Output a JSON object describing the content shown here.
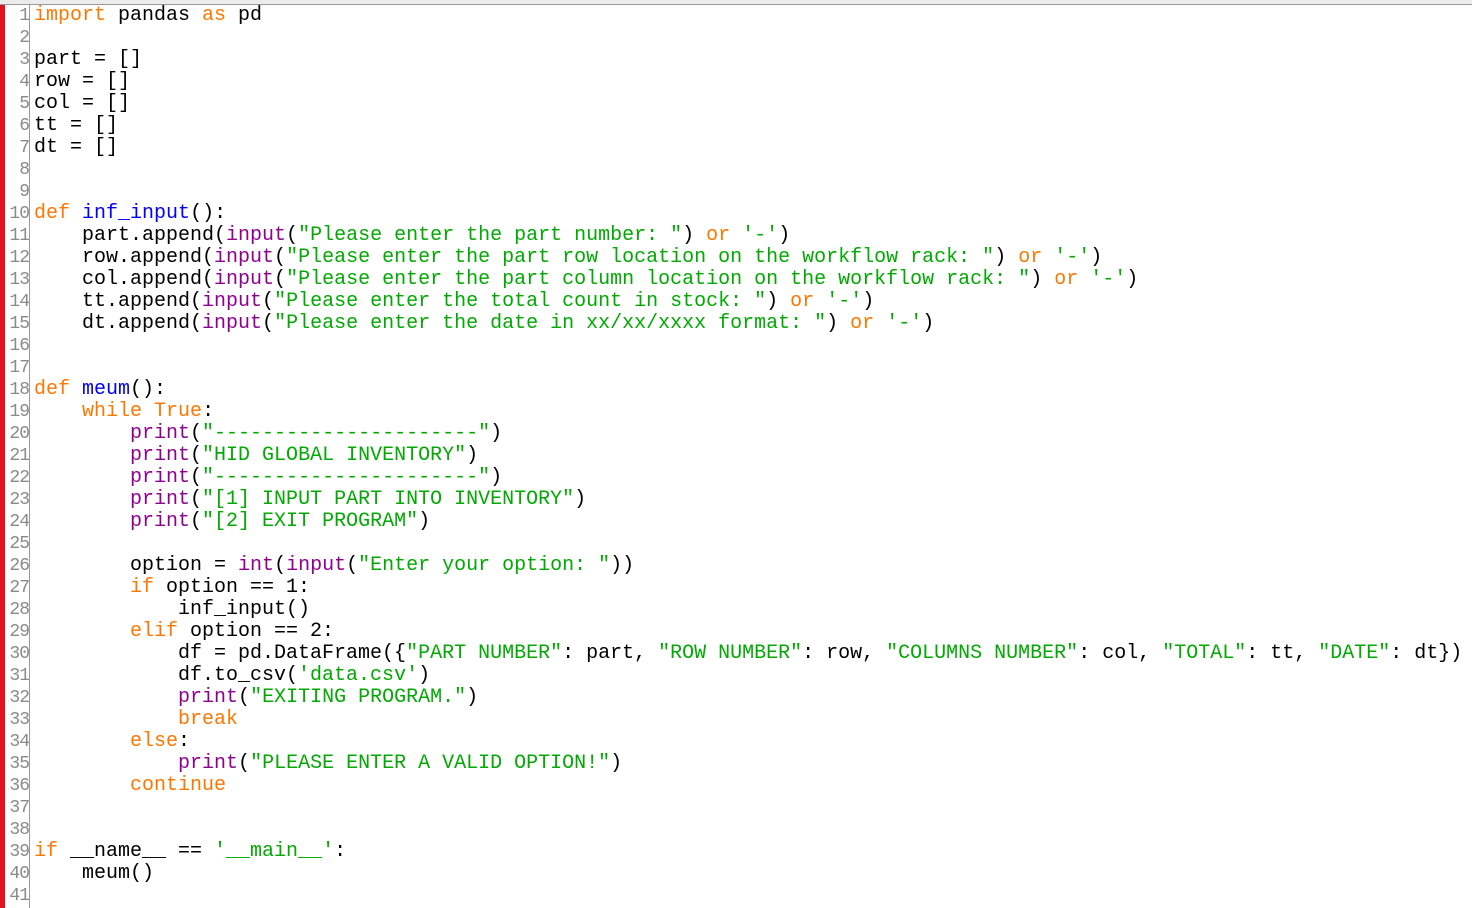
{
  "editor": {
    "colors": {
      "keyword": "#ff7700",
      "function_def": "#0000ff",
      "builtin": "#900090",
      "string": "#00aa00",
      "plain": "#000000",
      "line_number": "#8a8a8a",
      "margin_marker": "#e0141e"
    },
    "lines": [
      {
        "n": "1",
        "tokens": [
          {
            "t": "kw",
            "v": "import"
          },
          {
            "t": "pl",
            "v": " pandas "
          },
          {
            "t": "kw",
            "v": "as"
          },
          {
            "t": "pl",
            "v": " pd"
          }
        ]
      },
      {
        "n": "2",
        "tokens": []
      },
      {
        "n": "3",
        "tokens": [
          {
            "t": "pl",
            "v": "part = []"
          }
        ]
      },
      {
        "n": "4",
        "tokens": [
          {
            "t": "pl",
            "v": "row = []"
          }
        ]
      },
      {
        "n": "5",
        "tokens": [
          {
            "t": "pl",
            "v": "col = []"
          }
        ]
      },
      {
        "n": "6",
        "tokens": [
          {
            "t": "pl",
            "v": "tt = []"
          }
        ]
      },
      {
        "n": "7",
        "tokens": [
          {
            "t": "pl",
            "v": "dt = []"
          }
        ]
      },
      {
        "n": "8",
        "tokens": []
      },
      {
        "n": "9",
        "tokens": []
      },
      {
        "n": "10",
        "tokens": [
          {
            "t": "kw",
            "v": "def"
          },
          {
            "t": "pl",
            "v": " "
          },
          {
            "t": "fn",
            "v": "inf_input"
          },
          {
            "t": "pl",
            "v": "():"
          }
        ]
      },
      {
        "n": "11",
        "tokens": [
          {
            "t": "pl",
            "v": "    part.append("
          },
          {
            "t": "bi",
            "v": "input"
          },
          {
            "t": "pl",
            "v": "("
          },
          {
            "t": "str",
            "v": "\"Please enter the part number: \""
          },
          {
            "t": "pl",
            "v": ") "
          },
          {
            "t": "kw",
            "v": "or"
          },
          {
            "t": "pl",
            "v": " "
          },
          {
            "t": "str",
            "v": "'-'"
          },
          {
            "t": "pl",
            "v": ")"
          }
        ]
      },
      {
        "n": "12",
        "tokens": [
          {
            "t": "pl",
            "v": "    row.append("
          },
          {
            "t": "bi",
            "v": "input"
          },
          {
            "t": "pl",
            "v": "("
          },
          {
            "t": "str",
            "v": "\"Please enter the part row location on the workflow rack: \""
          },
          {
            "t": "pl",
            "v": ") "
          },
          {
            "t": "kw",
            "v": "or"
          },
          {
            "t": "pl",
            "v": " "
          },
          {
            "t": "str",
            "v": "'-'"
          },
          {
            "t": "pl",
            "v": ")"
          }
        ]
      },
      {
        "n": "13",
        "tokens": [
          {
            "t": "pl",
            "v": "    col.append("
          },
          {
            "t": "bi",
            "v": "input"
          },
          {
            "t": "pl",
            "v": "("
          },
          {
            "t": "str",
            "v": "\"Please enter the part column location on the workflow rack: \""
          },
          {
            "t": "pl",
            "v": ") "
          },
          {
            "t": "kw",
            "v": "or"
          },
          {
            "t": "pl",
            "v": " "
          },
          {
            "t": "str",
            "v": "'-'"
          },
          {
            "t": "pl",
            "v": ")"
          }
        ]
      },
      {
        "n": "14",
        "tokens": [
          {
            "t": "pl",
            "v": "    tt.append("
          },
          {
            "t": "bi",
            "v": "input"
          },
          {
            "t": "pl",
            "v": "("
          },
          {
            "t": "str",
            "v": "\"Please enter the total count in stock: \""
          },
          {
            "t": "pl",
            "v": ") "
          },
          {
            "t": "kw",
            "v": "or"
          },
          {
            "t": "pl",
            "v": " "
          },
          {
            "t": "str",
            "v": "'-'"
          },
          {
            "t": "pl",
            "v": ")"
          }
        ]
      },
      {
        "n": "15",
        "tokens": [
          {
            "t": "pl",
            "v": "    dt.append("
          },
          {
            "t": "bi",
            "v": "input"
          },
          {
            "t": "pl",
            "v": "("
          },
          {
            "t": "str",
            "v": "\"Please enter the date in xx/xx/xxxx format: \""
          },
          {
            "t": "pl",
            "v": ") "
          },
          {
            "t": "kw",
            "v": "or"
          },
          {
            "t": "pl",
            "v": " "
          },
          {
            "t": "str",
            "v": "'-'"
          },
          {
            "t": "pl",
            "v": ")"
          }
        ]
      },
      {
        "n": "16",
        "tokens": []
      },
      {
        "n": "17",
        "tokens": []
      },
      {
        "n": "18",
        "tokens": [
          {
            "t": "kw",
            "v": "def"
          },
          {
            "t": "pl",
            "v": " "
          },
          {
            "t": "fn",
            "v": "meum"
          },
          {
            "t": "pl",
            "v": "():"
          }
        ]
      },
      {
        "n": "19",
        "tokens": [
          {
            "t": "pl",
            "v": "    "
          },
          {
            "t": "kw",
            "v": "while"
          },
          {
            "t": "pl",
            "v": " "
          },
          {
            "t": "kw",
            "v": "True"
          },
          {
            "t": "pl",
            "v": ":"
          }
        ]
      },
      {
        "n": "20",
        "tokens": [
          {
            "t": "pl",
            "v": "        "
          },
          {
            "t": "bi",
            "v": "print"
          },
          {
            "t": "pl",
            "v": "("
          },
          {
            "t": "str",
            "v": "\"----------------------\""
          },
          {
            "t": "pl",
            "v": ")"
          }
        ]
      },
      {
        "n": "21",
        "tokens": [
          {
            "t": "pl",
            "v": "        "
          },
          {
            "t": "bi",
            "v": "print"
          },
          {
            "t": "pl",
            "v": "("
          },
          {
            "t": "str",
            "v": "\"HID GLOBAL INVENTORY\""
          },
          {
            "t": "pl",
            "v": ")"
          }
        ]
      },
      {
        "n": "22",
        "tokens": [
          {
            "t": "pl",
            "v": "        "
          },
          {
            "t": "bi",
            "v": "print"
          },
          {
            "t": "pl",
            "v": "("
          },
          {
            "t": "str",
            "v": "\"----------------------\""
          },
          {
            "t": "pl",
            "v": ")"
          }
        ]
      },
      {
        "n": "23",
        "tokens": [
          {
            "t": "pl",
            "v": "        "
          },
          {
            "t": "bi",
            "v": "print"
          },
          {
            "t": "pl",
            "v": "("
          },
          {
            "t": "str",
            "v": "\"[1] INPUT PART INTO INVENTORY\""
          },
          {
            "t": "pl",
            "v": ")"
          }
        ]
      },
      {
        "n": "24",
        "tokens": [
          {
            "t": "pl",
            "v": "        "
          },
          {
            "t": "bi",
            "v": "print"
          },
          {
            "t": "pl",
            "v": "("
          },
          {
            "t": "str",
            "v": "\"[2] EXIT PROGRAM\""
          },
          {
            "t": "pl",
            "v": ")"
          }
        ]
      },
      {
        "n": "25",
        "tokens": []
      },
      {
        "n": "26",
        "tokens": [
          {
            "t": "pl",
            "v": "        option = "
          },
          {
            "t": "bi",
            "v": "int"
          },
          {
            "t": "pl",
            "v": "("
          },
          {
            "t": "bi",
            "v": "input"
          },
          {
            "t": "pl",
            "v": "("
          },
          {
            "t": "str",
            "v": "\"Enter your option: \""
          },
          {
            "t": "pl",
            "v": "))"
          }
        ]
      },
      {
        "n": "27",
        "tokens": [
          {
            "t": "pl",
            "v": "        "
          },
          {
            "t": "kw",
            "v": "if"
          },
          {
            "t": "pl",
            "v": " option == 1:"
          }
        ]
      },
      {
        "n": "28",
        "tokens": [
          {
            "t": "pl",
            "v": "            inf_input()"
          }
        ]
      },
      {
        "n": "29",
        "tokens": [
          {
            "t": "pl",
            "v": "        "
          },
          {
            "t": "kw",
            "v": "elif"
          },
          {
            "t": "pl",
            "v": " option == 2:"
          }
        ]
      },
      {
        "n": "30",
        "tokens": [
          {
            "t": "pl",
            "v": "            df = pd.DataFrame({"
          },
          {
            "t": "str",
            "v": "\"PART NUMBER\""
          },
          {
            "t": "pl",
            "v": ": part, "
          },
          {
            "t": "str",
            "v": "\"ROW NUMBER\""
          },
          {
            "t": "pl",
            "v": ": row, "
          },
          {
            "t": "str",
            "v": "\"COLUMNS NUMBER\""
          },
          {
            "t": "pl",
            "v": ": col, "
          },
          {
            "t": "str",
            "v": "\"TOTAL\""
          },
          {
            "t": "pl",
            "v": ": tt, "
          },
          {
            "t": "str",
            "v": "\"DATE\""
          },
          {
            "t": "pl",
            "v": ": dt})"
          }
        ]
      },
      {
        "n": "31",
        "tokens": [
          {
            "t": "pl",
            "v": "            df.to_csv("
          },
          {
            "t": "str",
            "v": "'data.csv'"
          },
          {
            "t": "pl",
            "v": ")"
          }
        ]
      },
      {
        "n": "32",
        "tokens": [
          {
            "t": "pl",
            "v": "            "
          },
          {
            "t": "bi",
            "v": "print"
          },
          {
            "t": "pl",
            "v": "("
          },
          {
            "t": "str",
            "v": "\"EXITING PROGRAM.\""
          },
          {
            "t": "pl",
            "v": ")"
          }
        ]
      },
      {
        "n": "33",
        "tokens": [
          {
            "t": "pl",
            "v": "            "
          },
          {
            "t": "kw",
            "v": "break"
          }
        ]
      },
      {
        "n": "34",
        "tokens": [
          {
            "t": "pl",
            "v": "        "
          },
          {
            "t": "kw",
            "v": "else"
          },
          {
            "t": "pl",
            "v": ":"
          }
        ]
      },
      {
        "n": "35",
        "tokens": [
          {
            "t": "pl",
            "v": "            "
          },
          {
            "t": "bi",
            "v": "print"
          },
          {
            "t": "pl",
            "v": "("
          },
          {
            "t": "str",
            "v": "\"PLEASE ENTER A VALID OPTION!\""
          },
          {
            "t": "pl",
            "v": ")"
          }
        ]
      },
      {
        "n": "36",
        "tokens": [
          {
            "t": "pl",
            "v": "        "
          },
          {
            "t": "kw",
            "v": "continue"
          }
        ]
      },
      {
        "n": "37",
        "tokens": []
      },
      {
        "n": "38",
        "tokens": []
      },
      {
        "n": "39",
        "tokens": [
          {
            "t": "kw",
            "v": "if"
          },
          {
            "t": "pl",
            "v": " __name__ == "
          },
          {
            "t": "str",
            "v": "'__main__'"
          },
          {
            "t": "pl",
            "v": ":"
          }
        ]
      },
      {
        "n": "40",
        "tokens": [
          {
            "t": "pl",
            "v": "    meum()"
          }
        ]
      },
      {
        "n": "41",
        "tokens": []
      }
    ]
  }
}
